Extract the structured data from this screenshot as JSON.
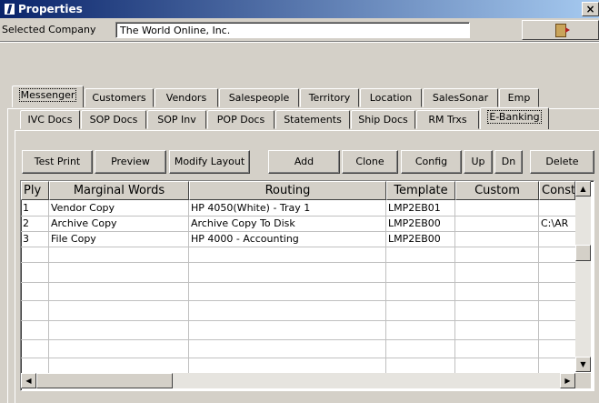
{
  "window": {
    "title": "Properties",
    "close_label": "×"
  },
  "company": {
    "label": "Selected Company",
    "value": "The World Online, Inc."
  },
  "main_tabs": [
    "Messenger",
    "Customers",
    "Vendors",
    "Salespeople",
    "Territory",
    "Location",
    "SalesSonar",
    "Emp"
  ],
  "sub_tabs": [
    "IVC Docs",
    "SOP Docs",
    "SOP Inv",
    "POP Docs",
    "Statements",
    "Ship Docs",
    "RM Trxs",
    "E-Banking"
  ],
  "active_sub_tab": "E-Banking",
  "toolbar": [
    "Test Print",
    "Preview",
    "Modify Layout",
    "Add",
    "Clone",
    "Config",
    "Up",
    "Dn",
    "Delete"
  ],
  "grid": {
    "columns": [
      "Ply",
      "Marginal Words",
      "Routing",
      "Template",
      "Custom",
      "Const"
    ],
    "rows": [
      [
        "1",
        "Vendor Copy",
        "HP 4050(White) - Tray 1",
        "LMP2EB01",
        "",
        ""
      ],
      [
        "2",
        "Archive Copy",
        "Archive Copy To Disk",
        "LMP2EB00",
        "",
        "C:\\AR"
      ],
      [
        "3",
        "File Copy",
        "HP 4000 - Accounting",
        "LMP2EB00",
        "",
        ""
      ]
    ]
  },
  "scroll": {
    "up_glyph": "▲",
    "down_glyph": "▼",
    "left_glyph": "◀",
    "right_glyph": "▶"
  }
}
